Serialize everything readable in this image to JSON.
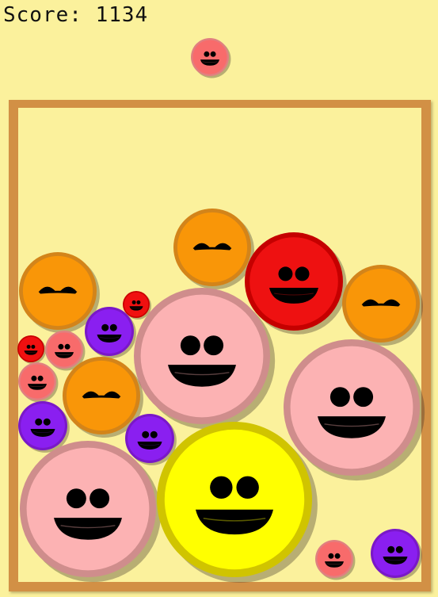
{
  "score": {
    "label": "Score: ",
    "value": "1134"
  },
  "colors": {
    "background": "#fbf19c",
    "container": "#d29045"
  },
  "next_fruit": {
    "kind": "salmon",
    "face": "smile"
  },
  "fruits": [
    {
      "kind": "salmon",
      "face": "smile"
    },
    {
      "kind": "orange",
      "face": "sleepy"
    },
    {
      "kind": "red",
      "face": "smile"
    },
    {
      "kind": "orange",
      "face": "sleepy"
    },
    {
      "kind": "red-small",
      "face": "smile"
    },
    {
      "kind": "orange",
      "face": "sleepy"
    },
    {
      "kind": "purple",
      "face": "smile"
    },
    {
      "kind": "pink",
      "face": "smile"
    },
    {
      "kind": "red-small",
      "face": "smile"
    },
    {
      "kind": "salmon",
      "face": "smile"
    },
    {
      "kind": "salmon",
      "face": "smile"
    },
    {
      "kind": "orange",
      "face": "sleepy"
    },
    {
      "kind": "purple",
      "face": "smile"
    },
    {
      "kind": "purple",
      "face": "smile"
    },
    {
      "kind": "pink",
      "face": "smile"
    },
    {
      "kind": "pink",
      "face": "smile"
    },
    {
      "kind": "yellow",
      "face": "smile"
    },
    {
      "kind": "salmon",
      "face": "smile"
    },
    {
      "kind": "purple",
      "face": "smile"
    }
  ],
  "fruit_colors": {
    "salmon": {
      "fill": "#f86b6b",
      "rim": "#e08080"
    },
    "red-small": {
      "fill": "#f01010",
      "rim": "#c80000"
    },
    "red": {
      "fill": "#ee1111",
      "rim": "#c50000"
    },
    "orange": {
      "fill": "#f99608",
      "rim": "#d3841a"
    },
    "purple": {
      "fill": "#8a1ff0",
      "rim": "#7a18c8"
    },
    "pink": {
      "fill": "#fcb2b3",
      "rim": "#cf8d8c"
    },
    "yellow": {
      "fill": "#ffff00",
      "rim": "#d0c400"
    }
  }
}
